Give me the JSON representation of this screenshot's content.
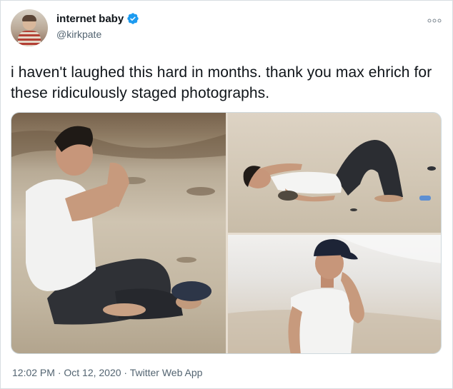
{
  "author": {
    "display_name": "internet baby",
    "handle": "@kirkpate",
    "verified_icon": "verified-badge-icon",
    "avatar_icon": "avatar"
  },
  "tweet": {
    "text": "i haven't laughed this hard in months. thank you max ehrich for these ridiculously staged photographs.",
    "timestamp_line": "12:02 PM · Oct 12, 2020 · Twitter Web App"
  },
  "colors": {
    "text_primary": "#0f1419",
    "text_secondary": "#536471",
    "verified_blue": "#1d9bf0",
    "border": "#d8dde1"
  },
  "media": {
    "count": 3,
    "photos": [
      "photo-praying-on-beach",
      "photo-lying-on-beach",
      "photo-phone-call-on-beach"
    ]
  }
}
